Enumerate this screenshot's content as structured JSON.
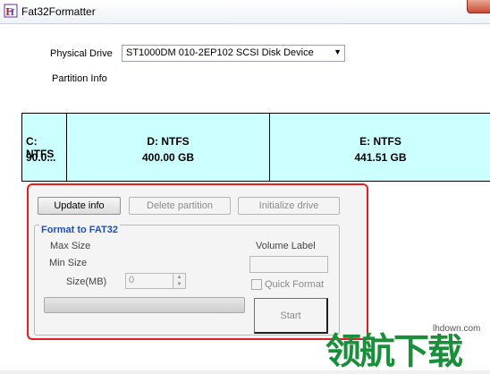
{
  "window": {
    "title": "Fat32Formatter"
  },
  "drive": {
    "label": "Physical Drive",
    "selected": "ST1000DM 010-2EP102 SCSI Disk Device",
    "partition_info_label": "Partition Info"
  },
  "partitions": [
    {
      "name": "C: NTFS",
      "size": "90.0..."
    },
    {
      "name": "D: NTFS",
      "size": "400.00 GB"
    },
    {
      "name": "E: NTFS",
      "size": "441.51 GB"
    }
  ],
  "actions": {
    "update": "Update info",
    "delete": "Delete partition",
    "initialize": "Initialize drive"
  },
  "format": {
    "group_title": "Format to FAT32",
    "max_size_label": "Max Size",
    "min_size_label": "Min Size",
    "size_label": "Size(MB)",
    "size_value": "0",
    "volume_label": "Volume Label",
    "volume_value": "",
    "quick_format": "Quick Format",
    "start": "Start"
  },
  "watermark": {
    "text": "领航下载",
    "url": "lhdown.com"
  },
  "colors": {
    "partition_bg": "#ccffff",
    "highlight_border": "#e02020",
    "group_title": "#1f4fc0",
    "watermark": "#1a8f3a"
  }
}
